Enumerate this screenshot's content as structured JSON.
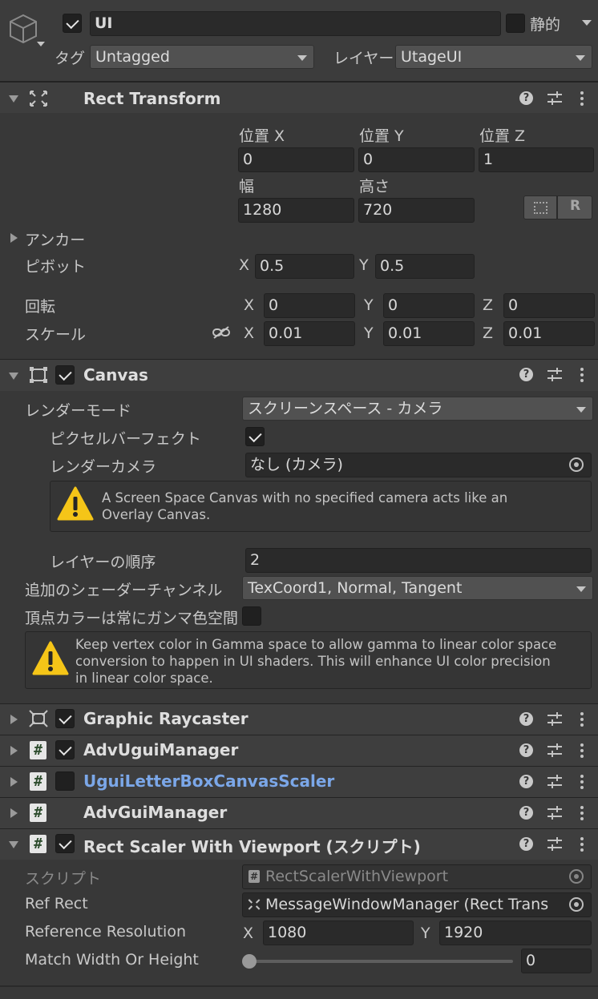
{
  "gameobject": {
    "name": "UI",
    "active": true,
    "static_label": "静的",
    "tag_label": "タグ",
    "tag_value": "Untagged",
    "layer_label": "レイヤー",
    "layer_value": "UtageUI"
  },
  "rect_transform": {
    "title": "Rect Transform",
    "pos_x_label": "位置 X",
    "pos_y_label": "位置 Y",
    "pos_z_label": "位置 Z",
    "pos_x": "0",
    "pos_y": "0",
    "pos_z": "1",
    "width_label": "幅",
    "height_label": "高さ",
    "width": "1280",
    "height": "720",
    "anchor_label": "アンカー",
    "pivot_label": "ピボット",
    "pivot_x": "0.5",
    "pivot_y": "0.5",
    "rotation_label": "回転",
    "rot_x": "0",
    "rot_y": "0",
    "rot_z": "0",
    "scale_label": "スケール",
    "scale_x": "0.01",
    "scale_y": "0.01",
    "scale_z": "0.01",
    "raw_button": "R"
  },
  "axes": {
    "x": "X",
    "y": "Y",
    "z": "Z"
  },
  "canvas": {
    "title": "Canvas",
    "enabled": true,
    "render_mode_label": "レンダーモード",
    "render_mode_value": "スクリーンスペース - カメラ",
    "pixel_perfect_label": "ピクセルバーフェクト",
    "pixel_perfect": true,
    "render_camera_label": "レンダーカメラ",
    "render_camera_value": "なし (カメラ)",
    "warning1_line1": "A Screen Space Canvas with no specified camera acts like an",
    "warning1_line2": "Overlay Canvas.",
    "sort_order_label": "レイヤーの順序",
    "sort_order_value": "2",
    "shader_channels_label": "追加のシェーダーチャンネル",
    "shader_channels_value": "TexCoord1, Normal, Tangent",
    "vertex_color_label": "頂点カラーは常にガンマ色空間に",
    "vertex_color_checked": false,
    "warning2_line1": "Keep vertex color in Gamma space to allow gamma to linear color space",
    "warning2_line2": "conversion to happen in UI shaders. This will enhance UI color precision",
    "warning2_line3": "in linear color space."
  },
  "components": [
    {
      "title": "Graphic Raycaster",
      "enabled": true
    },
    {
      "title": "AdvUguiManager",
      "enabled": true
    },
    {
      "title": "UguiLetterBoxCanvasScaler",
      "enabled": false,
      "color": "#7ba7e8"
    },
    {
      "title": "AdvGuiManager"
    }
  ],
  "rect_scaler": {
    "title": "Rect Scaler With Viewport (スクリプト)",
    "enabled": true,
    "script_label": "スクリプト",
    "script_value": "RectScalerWithViewport",
    "ref_rect_label": "Ref Rect",
    "ref_rect_value": "MessageWindowManager (Rect Trans",
    "ref_res_label": "Reference Resolution",
    "ref_res_x": "1080",
    "ref_res_y": "1920",
    "match_label": "Match Width Or Height",
    "match_value": "0",
    "match_fraction": 0
  },
  "icons": [
    "gameobject-cube-icon",
    "rect-transform-icon",
    "canvas-icon",
    "graphic-raycaster-icon",
    "script-hash-icon",
    "help-icon",
    "presets-icon",
    "kebab-menu-icon",
    "warning-icon",
    "object-picker-icon",
    "link-scale-icon",
    "blueprint-icon",
    "raw-edit-icon"
  ]
}
